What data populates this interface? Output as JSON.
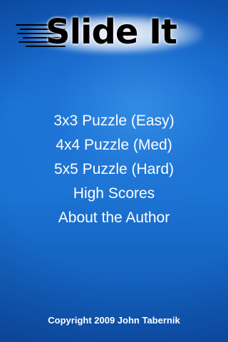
{
  "logo": {
    "title": "Slide It"
  },
  "menu": {
    "items": [
      "3x3 Puzzle (Easy)",
      "4x4 Puzzle (Med)",
      "5x5 Puzzle (Hard)",
      "High Scores",
      "About the Author"
    ]
  },
  "footer": {
    "copyright": "Copyright 2009 John Tabernik"
  },
  "colors": {
    "background": "#1b74d4",
    "text": "#ffffff",
    "logo_text": "#000000"
  }
}
